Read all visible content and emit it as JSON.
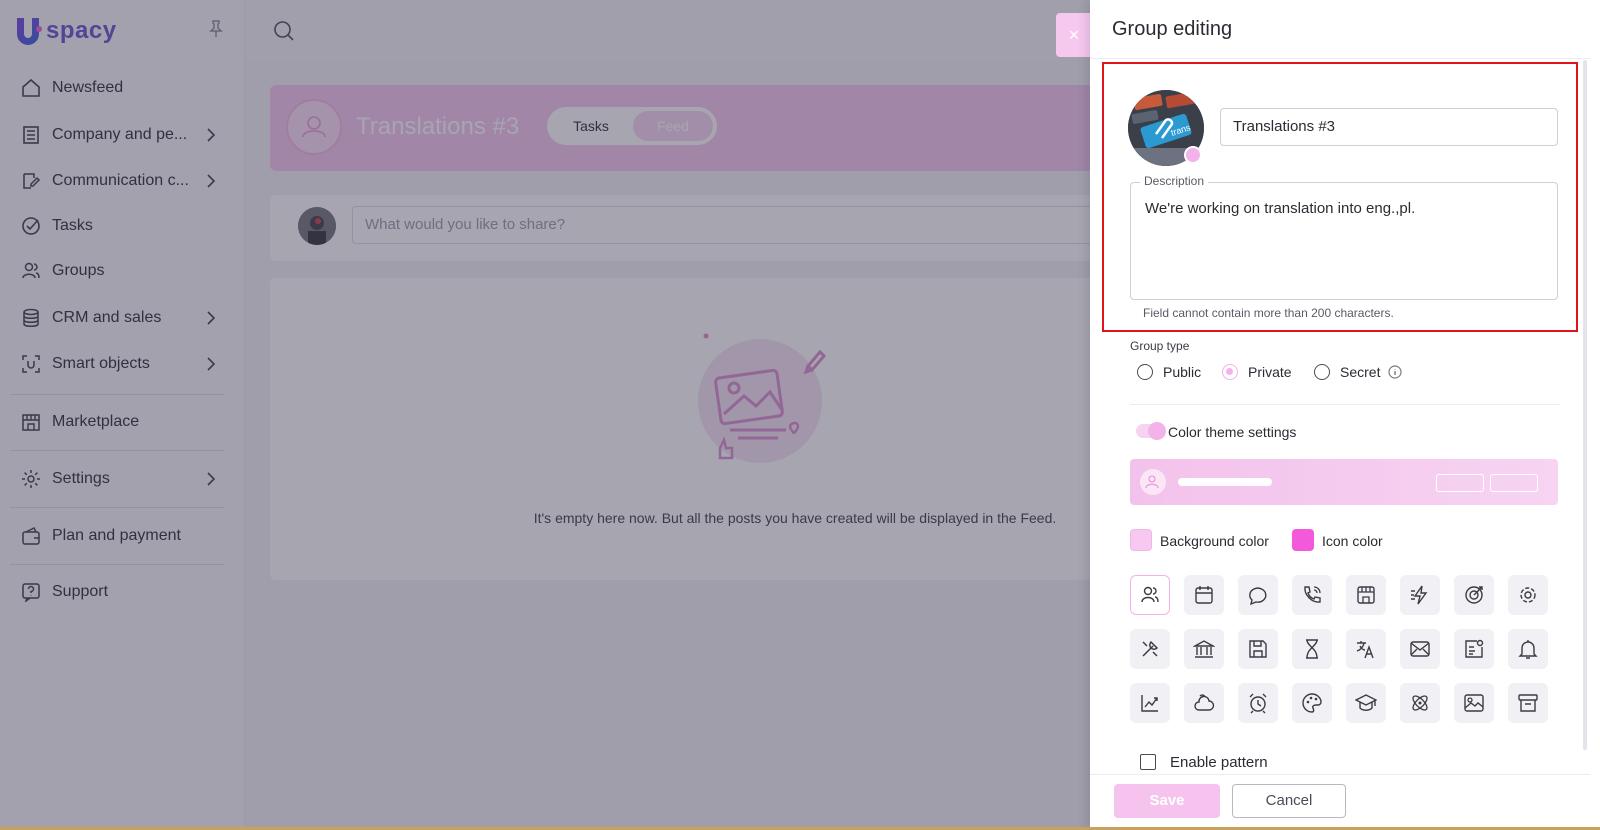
{
  "app": {
    "logo_text": "spacy",
    "logo_mark": "U"
  },
  "sidebar": {
    "items": [
      {
        "label": "Newsfeed",
        "icon": "home-icon",
        "has_children": false
      },
      {
        "label": "Company and pe...",
        "icon": "building-icon",
        "has_children": true
      },
      {
        "label": "Communication c...",
        "icon": "chat-edit-icon",
        "has_children": true
      },
      {
        "label": "Tasks",
        "icon": "check-circle-icon",
        "has_children": false
      },
      {
        "label": "Groups",
        "icon": "users-icon",
        "has_children": false
      },
      {
        "label": "CRM and sales",
        "icon": "database-icon",
        "has_children": true
      },
      {
        "label": "Smart objects",
        "icon": "smart-object-icon",
        "has_children": true
      },
      {
        "label": "Marketplace",
        "icon": "store-icon",
        "has_children": false
      },
      {
        "label": "Settings",
        "icon": "gear-icon",
        "has_children": true
      },
      {
        "label": "Plan and payment",
        "icon": "wallet-icon",
        "has_children": false
      },
      {
        "label": "Support",
        "icon": "help-icon",
        "has_children": false
      }
    ]
  },
  "group_page": {
    "title": "Translations #3",
    "tabs": [
      {
        "label": "Tasks"
      },
      {
        "label": "Feed"
      }
    ],
    "composer_placeholder": "What would you like to share?",
    "empty_text": "It's empty here now. But all the posts you have created will be displayed in the Feed."
  },
  "drawer": {
    "title": "Group editing",
    "close_glyph": "×",
    "name_value": "Translations #3",
    "description_label": "Description",
    "description_value": "We're working on translation into eng.,pl.",
    "description_hint": "Field cannot contain more than 200 characters.",
    "group_type_label": "Group type",
    "group_types": [
      {
        "label": "Public",
        "selected": false
      },
      {
        "label": "Private",
        "selected": true
      },
      {
        "label": "Secret",
        "selected": false
      }
    ],
    "color_theme_label": "Color theme settings",
    "color_theme_enabled": true,
    "background_color_label": "Background color",
    "background_color": "#f7c9f0",
    "icon_color_label": "Icon color",
    "icon_color": "#f25ad9",
    "icons": [
      "users-icon",
      "calendar-icon",
      "chat-bubble-icon",
      "phone-icon",
      "building-icon",
      "lightning-icon",
      "target-icon",
      "gear-icon",
      "tools-icon",
      "bank-icon",
      "save-icon",
      "hourglass-icon",
      "translate-icon",
      "mail-icon",
      "id-card-icon",
      "bell-icon",
      "chart-icon",
      "cloud-icon",
      "alarm-icon",
      "palette-icon",
      "graduation-icon",
      "atom-icon",
      "image-icon",
      "archive-icon"
    ],
    "selected_icon": "users-icon",
    "enable_pattern_label": "Enable pattern",
    "enable_pattern_checked": false,
    "save_label": "Save",
    "cancel_label": "Cancel"
  },
  "colors": {
    "accent": "#f3b3ea",
    "brand": "#6a4fd0",
    "highlight_border": "#e0141a"
  }
}
